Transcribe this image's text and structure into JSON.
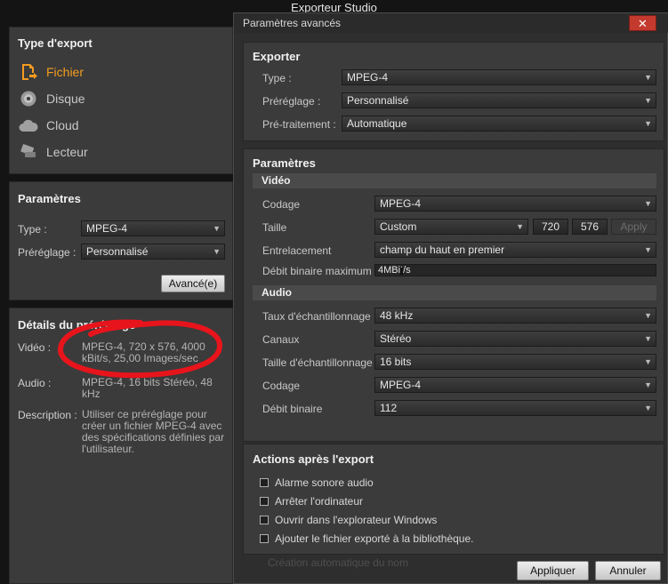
{
  "app_title": "Exporteur Studio",
  "left": {
    "export_type": {
      "title": "Type d'export",
      "items": [
        {
          "label": "Fichier",
          "icon": "file-export-icon",
          "active": true
        },
        {
          "label": "Disque",
          "icon": "disc-icon",
          "active": false
        },
        {
          "label": "Cloud",
          "icon": "cloud-icon",
          "active": false
        },
        {
          "label": "Lecteur",
          "icon": "device-icon",
          "active": false
        }
      ]
    },
    "params": {
      "title": "Paramètres",
      "type_label": "Type :",
      "type_value": "MPEG-4",
      "preset_label": "Préréglage :",
      "preset_value": "Personnalisé",
      "advanced_button": "Avancé(e)"
    },
    "details": {
      "title": "Détails du préréglage",
      "video_label": "Vidéo :",
      "video_value": "MPEG-4, 720 x 576, 4000 kBit/s, 25,00 Images/sec",
      "audio_label": "Audio :",
      "audio_value": "MPEG-4, 16 bits Stéréo, 48 kHz",
      "desc_label": "Description :",
      "desc_value": "Utiliser ce préréglage pour créer un fichier MPEG-4 avec des spécifications définies par l'utilisateur."
    }
  },
  "dialog": {
    "title": "Paramètres avancés",
    "close": "✕",
    "exporter": {
      "title": "Exporter",
      "type_label": "Type :",
      "type_value": "MPEG-4",
      "preset_label": "Préréglage :",
      "preset_value": "Personnalisé",
      "pre_label": "Pré-traitement :",
      "pre_value": "Automatique"
    },
    "parametres": {
      "title": "Paramètres",
      "video_header": "Vidéo",
      "codec_label": "Codage",
      "codec_value": "MPEG-4",
      "size_label": "Taille",
      "size_value": "Custom",
      "width": "720",
      "height": "576",
      "apply_small": "Apply",
      "interlace_label": "Entrelacement",
      "interlace_value": "champ du haut en premier",
      "bitrate_max_label": "Débit binaire maximum",
      "bitrate_max_value": "4MBit/s",
      "bitrate_slider_fraction": 0.37,
      "audio_header": "Audio",
      "sample_rate_label": "Taux d'échantillonnage",
      "sample_rate_value": "48 kHz",
      "channels_label": "Canaux",
      "channels_value": "Stéréo",
      "sample_size_label": "Taille d'échantillonnage",
      "sample_size_value": "16 bits",
      "acodec_label": "Codage",
      "acodec_value": "MPEG-4",
      "abitrate_label": "Débit binaire",
      "abitrate_value": "112"
    },
    "actions": {
      "title": "Actions après l'export",
      "items": [
        "Alarme sonore audio",
        "Arrêter l'ordinateur",
        "Ouvrir dans l'explorateur Windows",
        "Ajouter le fichier exporté à la bibliothèque."
      ],
      "faded_text": "Création automatique du nom"
    },
    "apply_button": "Appliquer",
    "cancel_button": "Annuler"
  },
  "colors": {
    "accent": "#f39c1f",
    "close": "#c43a2f",
    "annotation": "#e8141c"
  }
}
